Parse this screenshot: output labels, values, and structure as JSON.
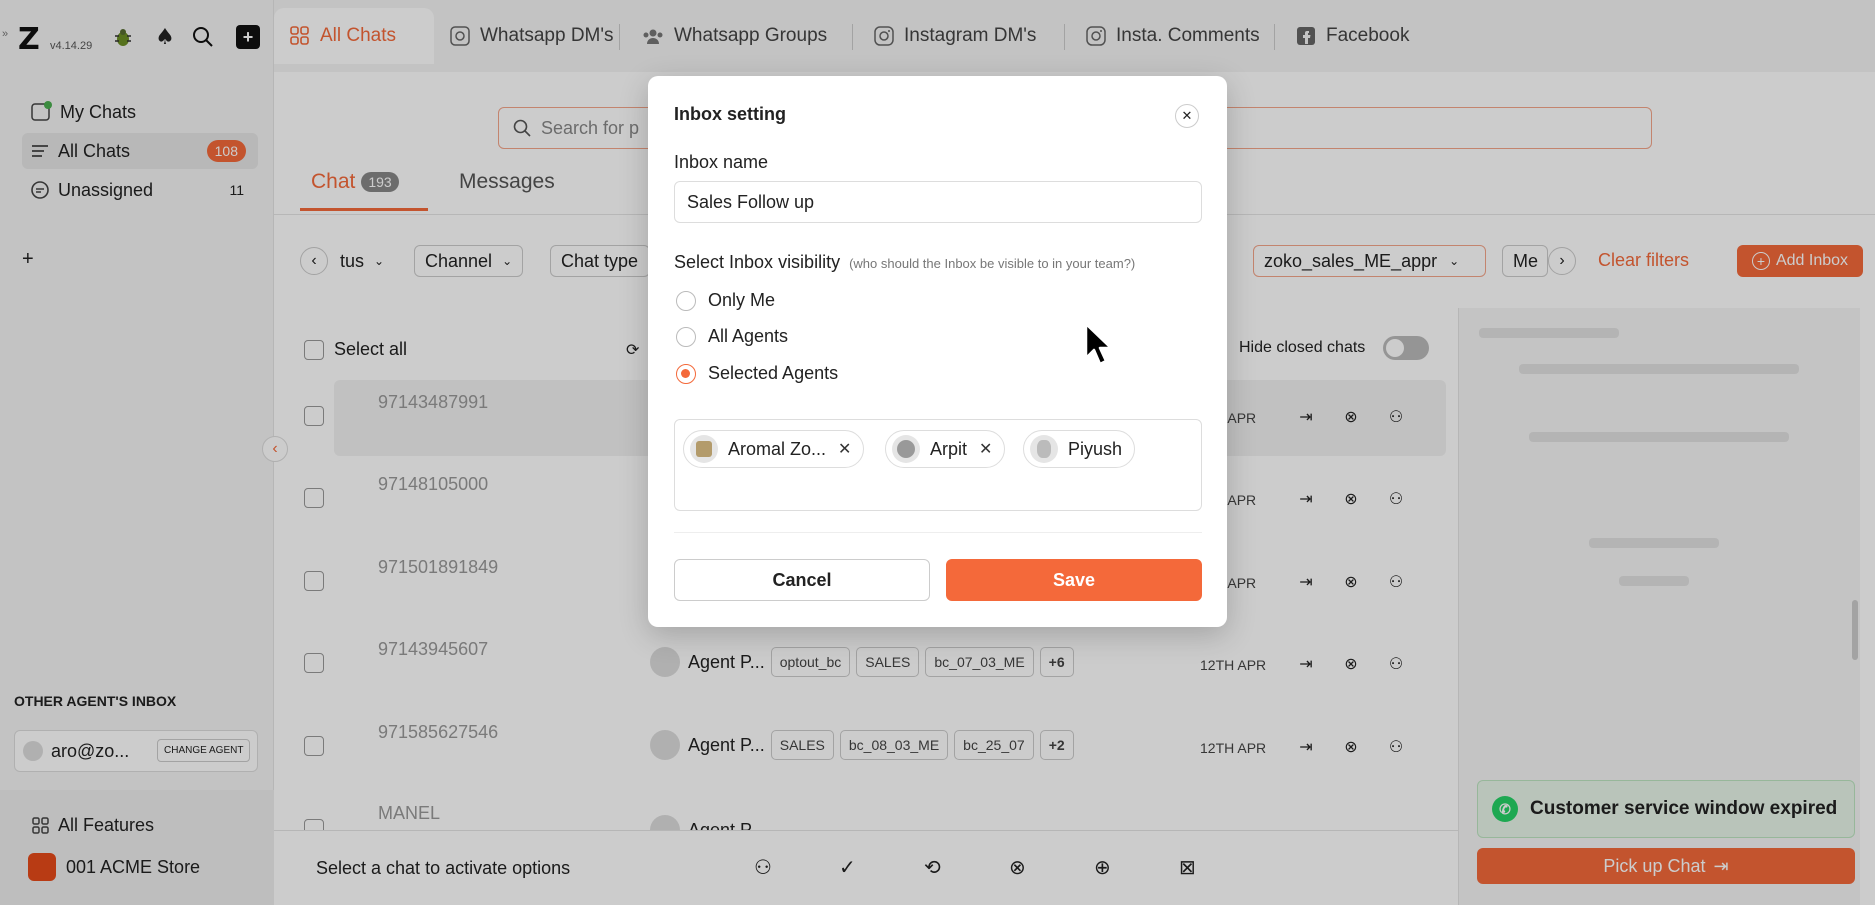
{
  "app": {
    "version": "v4.14.29",
    "logo": "Z"
  },
  "sidebar": {
    "items": [
      {
        "label": "My Chats"
      },
      {
        "label": "All Chats",
        "badge": "108"
      },
      {
        "label": "Unassigned",
        "badge": "11"
      }
    ],
    "add": "+",
    "other_inbox_heading": "OTHER AGENT'S INBOX",
    "agent_email": "aro@zo...",
    "change_agent": "CHANGE AGENT",
    "all_features": "All Features",
    "store": "001 ACME Store"
  },
  "tabs": [
    {
      "label": "All Chats",
      "icon": "grid-icon"
    },
    {
      "label": "Whatsapp DM's",
      "icon": "whatsapp-icon"
    },
    {
      "label": "Whatsapp Groups",
      "icon": "group-icon"
    },
    {
      "label": "Instagram DM's",
      "icon": "instagram-icon"
    },
    {
      "label": "Insta. Comments",
      "icon": "instagram-icon"
    },
    {
      "label": "Facebook",
      "icon": "facebook-icon"
    }
  ],
  "search": {
    "placeholder": "Search for p"
  },
  "subtabs": {
    "chat": "Chat",
    "chat_count": "193",
    "messages": "Messages"
  },
  "filters": {
    "status": "tus",
    "channel": "Channel",
    "chat_type": "Chat type",
    "inbox": "zoko_sales_ME_appr",
    "more": "Me",
    "clear": "Clear filters",
    "add_inbox": "Add Inbox"
  },
  "list": {
    "select_all": "Select all",
    "hide_closed": "Hide closed chats",
    "rows": [
      {
        "phone": "97143487991",
        "date": "12TH APR"
      },
      {
        "phone": "97148105000",
        "date": "12TH APR"
      },
      {
        "phone": "971501891849",
        "date": "12TH APR"
      },
      {
        "phone": "97143945607",
        "date": "12TH APR",
        "agent": "Agent P...",
        "tags": [
          "optout_bc",
          "SALES",
          "bc_07_03_ME"
        ],
        "more": "+6"
      },
      {
        "phone": "971585627546",
        "date": "12TH APR",
        "agent": "Agent P...",
        "tags": [
          "SALES",
          "bc_08_03_ME",
          "bc_25_07"
        ],
        "more": "+2"
      },
      {
        "phone": "MANEL",
        "date": "",
        "agent": "Agent P...",
        "tags": [],
        "more": ""
      }
    ]
  },
  "bottom_bar": {
    "text": "Select a chat to activate options"
  },
  "right_panel": {
    "csw": "Customer service window expired",
    "pickup": "Pick up Chat"
  },
  "modal": {
    "title": "Inbox setting",
    "name_label": "Inbox name",
    "name_value": "Sales Follow up",
    "visibility_label": "Select Inbox visibility",
    "visibility_hint": "(who should the Inbox be visible to in your team?)",
    "options": [
      {
        "label": "Only Me",
        "checked": false
      },
      {
        "label": "All Agents",
        "checked": false
      },
      {
        "label": "Selected Agents",
        "checked": true
      }
    ],
    "agents": [
      {
        "name": "Aromal Zo..."
      },
      {
        "name": "Arpit"
      },
      {
        "name": "Piyush"
      }
    ],
    "cancel": "Cancel",
    "save": "Save"
  },
  "colors": {
    "accent": "#f4693a",
    "success_bg": "#e8f5e9"
  }
}
